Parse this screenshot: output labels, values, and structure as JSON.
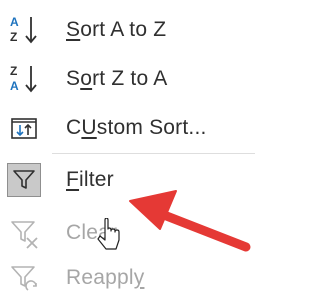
{
  "menu": {
    "items": [
      {
        "id": "sort-a-z",
        "accel": "S",
        "rest": "ort A to Z",
        "icon": "sort-a-to-z-icon",
        "enabled": true
      },
      {
        "id": "sort-z-a",
        "pre": "S",
        "accel": "o",
        "rest": "rt Z to A",
        "icon": "sort-z-to-a-icon",
        "enabled": true
      },
      {
        "id": "custom-sort",
        "accel": "U",
        "pre": "C",
        "rest": "stom Sort...",
        "icon": "custom-sort-icon",
        "enabled": true
      },
      {
        "id": "filter",
        "accel": "F",
        "rest": "ilter",
        "icon": "filter-icon",
        "enabled": true,
        "active": true
      },
      {
        "id": "clear",
        "text": "Clear",
        "icon": "clear-filter-icon",
        "enabled": false
      },
      {
        "id": "reapply",
        "accel": "y",
        "text": "Reappl",
        "icon": "reapply-filter-icon",
        "enabled": false
      }
    ]
  },
  "icon_letters": {
    "a": "A",
    "z": "Z"
  },
  "colors": {
    "text": "#303030",
    "disabled_text": "#a6a6a6",
    "accent_blue": "#1e73be",
    "annotation_arrow": "#e53935",
    "active_icon_bg": "#c9c9c9"
  }
}
